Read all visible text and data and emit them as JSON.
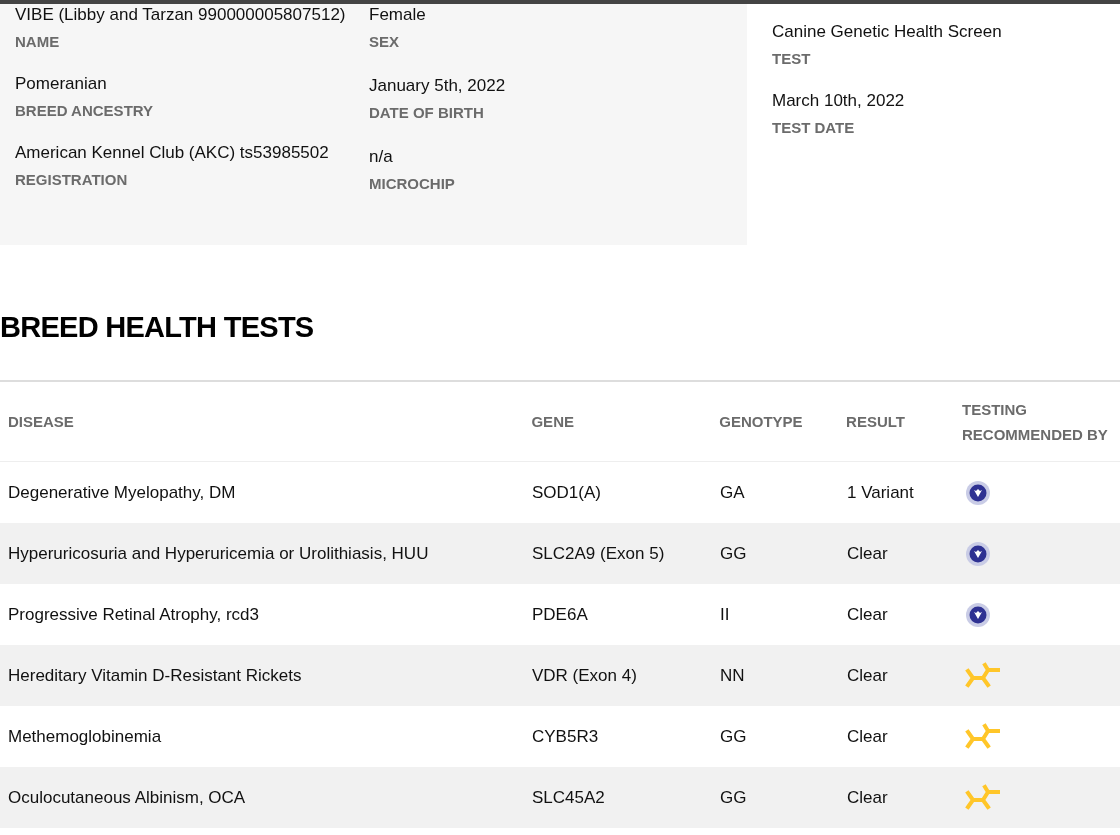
{
  "profile": {
    "left": [
      {
        "value": "VIBE (Libby and Tarzan 990000005807512)",
        "label": "NAME"
      },
      {
        "value": "Pomeranian",
        "label": "BREED ANCESTRY"
      },
      {
        "value": "American Kennel Club (AKC) ts53985502",
        "label": "REGISTRATION"
      }
    ],
    "middle": [
      {
        "value": "Female",
        "label": "SEX"
      },
      {
        "value": "January 5th, 2022",
        "label": "DATE OF BIRTH"
      },
      {
        "value": "n/a",
        "label": "MICROCHIP"
      }
    ],
    "right": [
      {
        "value": "Canine Genetic Health Screen",
        "label": "TEST"
      },
      {
        "value": "March 10th, 2022",
        "label": "TEST DATE"
      }
    ]
  },
  "section_title": "BREED HEALTH TESTS",
  "table": {
    "columns": [
      "DISEASE",
      "GENE",
      "GENOTYPE",
      "RESULT",
      "TESTING RECOMMENDED BY"
    ],
    "rows": [
      {
        "disease": "Degenerative Myelopathy, DM",
        "gene": "SOD1(A)",
        "genotype": "GA",
        "result": "1 Variant",
        "recommended_by": {
          "kind": "seal"
        }
      },
      {
        "disease": "Hyperuricosuria and Hyperuricemia or Urolithiasis, HUU",
        "gene": "SLC2A9 (Exon 5)",
        "genotype": "GG",
        "result": "Clear",
        "recommended_by": {
          "kind": "seal"
        }
      },
      {
        "disease": "Progressive Retinal Atrophy, rcd3",
        "gene": "PDE6A",
        "genotype": "II",
        "result": "Clear",
        "recommended_by": {
          "kind": "seal"
        }
      },
      {
        "disease": "Hereditary Vitamin D-Resistant Rickets",
        "gene": "VDR (Exon 4)",
        "genotype": "NN",
        "result": "Clear",
        "recommended_by": {
          "kind": "antibody"
        }
      },
      {
        "disease": "Methemoglobinemia",
        "gene": "CYB5R3",
        "genotype": "GG",
        "result": "Clear",
        "recommended_by": {
          "kind": "antibody"
        }
      },
      {
        "disease": "Oculocutaneous Albinism, OCA",
        "gene": "SLC45A2",
        "genotype": "GG",
        "result": "Clear",
        "recommended_by": {
          "kind": "antibody"
        }
      }
    ]
  }
}
